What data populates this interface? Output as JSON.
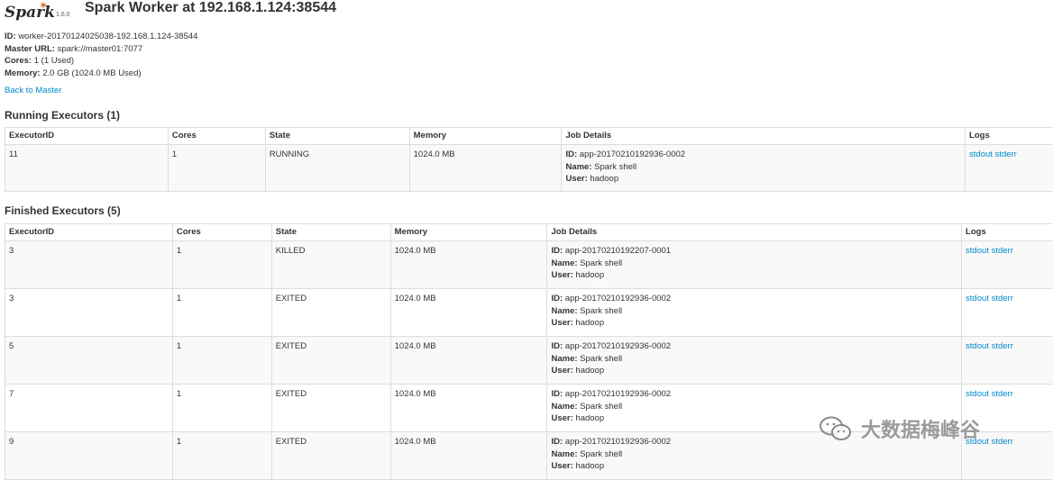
{
  "logo": {
    "word": "Spark",
    "version": "1.6.0"
  },
  "title": "Spark Worker at 192.168.1.124:38544",
  "info": [
    {
      "label": "ID:",
      "value": "worker-20170124025038-192.168.1.124-38544"
    },
    {
      "label": "Master URL:",
      "value": "spark://master01:7077"
    },
    {
      "label": "Cores:",
      "value": "1 (1 Used)"
    },
    {
      "label": "Memory:",
      "value": "2.0 GB (1024.0 MB Used)"
    }
  ],
  "back_link": "Back to Master",
  "columns": [
    "ExecutorID",
    "Cores",
    "State",
    "Memory",
    "Job Details",
    "Logs"
  ],
  "job_labels": {
    "id": "ID:",
    "name": "Name:",
    "user": "User:"
  },
  "logs": {
    "stdout": "stdout",
    "stderr": "stderr"
  },
  "running": {
    "title": "Running Executors (1)",
    "rows": [
      {
        "executor_id": "11",
        "cores": "1",
        "state": "RUNNING",
        "memory": "1024.0 MB",
        "job_id": "app-20170210192936-0002",
        "job_name": "Spark shell",
        "job_user": "hadoop"
      }
    ]
  },
  "finished": {
    "title": "Finished Executors (5)",
    "rows": [
      {
        "executor_id": "3",
        "cores": "1",
        "state": "KILLED",
        "memory": "1024.0 MB",
        "job_id": "app-20170210192207-0001",
        "job_name": "Spark shell",
        "job_user": "hadoop"
      },
      {
        "executor_id": "3",
        "cores": "1",
        "state": "EXITED",
        "memory": "1024.0 MB",
        "job_id": "app-20170210192936-0002",
        "job_name": "Spark shell",
        "job_user": "hadoop"
      },
      {
        "executor_id": "5",
        "cores": "1",
        "state": "EXITED",
        "memory": "1024.0 MB",
        "job_id": "app-20170210192936-0002",
        "job_name": "Spark shell",
        "job_user": "hadoop"
      },
      {
        "executor_id": "7",
        "cores": "1",
        "state": "EXITED",
        "memory": "1024.0 MB",
        "job_id": "app-20170210192936-0002",
        "job_name": "Spark shell",
        "job_user": "hadoop"
      },
      {
        "executor_id": "9",
        "cores": "1",
        "state": "EXITED",
        "memory": "1024.0 MB",
        "job_id": "app-20170210192936-0002",
        "job_name": "Spark shell",
        "job_user": "hadoop"
      }
    ]
  },
  "watermark": {
    "text": "大数据梅峰谷",
    "icon": "wechat-icon"
  }
}
